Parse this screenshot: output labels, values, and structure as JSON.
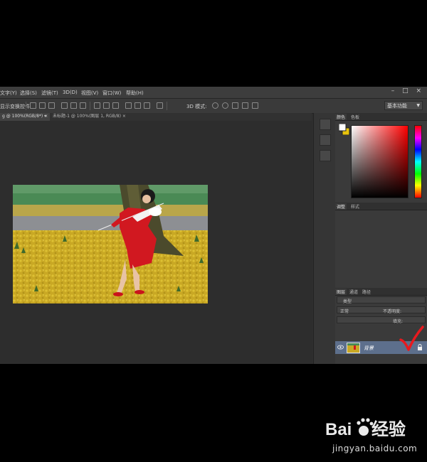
{
  "menu": {
    "items": [
      "文字(Y)",
      "选择(S)",
      "滤镜(T)",
      "3D(D)",
      "视图(V)",
      "窗口(W)",
      "帮助(H)"
    ]
  },
  "window_controls": "– □ ×",
  "options_bar": {
    "transform_label": "显示变换控件",
    "mode3d_label": "3D 模式:",
    "workspace": "基本功能"
  },
  "document_tabs": [
    {
      "label": "g @ 100%(RGB/8*)",
      "close": "×",
      "active": true
    },
    {
      "label": "未标题-1 @ 100%(图层 1, RGB/8)",
      "close": "×",
      "active": false
    }
  ],
  "panels": {
    "color_tabs": [
      "颜色",
      "色板"
    ],
    "adjust_tabs": [
      "调整",
      "样式"
    ],
    "layers_tabs": [
      "图层",
      "通道",
      "路径"
    ],
    "layer_kind": "类型",
    "blend_mode": "正常",
    "opacity_label": "不透明度:",
    "fill_label": "填充:"
  },
  "layer": {
    "name": "背景"
  },
  "colors": {
    "accent_check": "#e8191e",
    "layer_selected": "#5d6f8c",
    "app_bg": "#2e2e2e"
  },
  "watermark": {
    "brand": "Baidu经验",
    "site": "jingyan.baidu.com"
  }
}
